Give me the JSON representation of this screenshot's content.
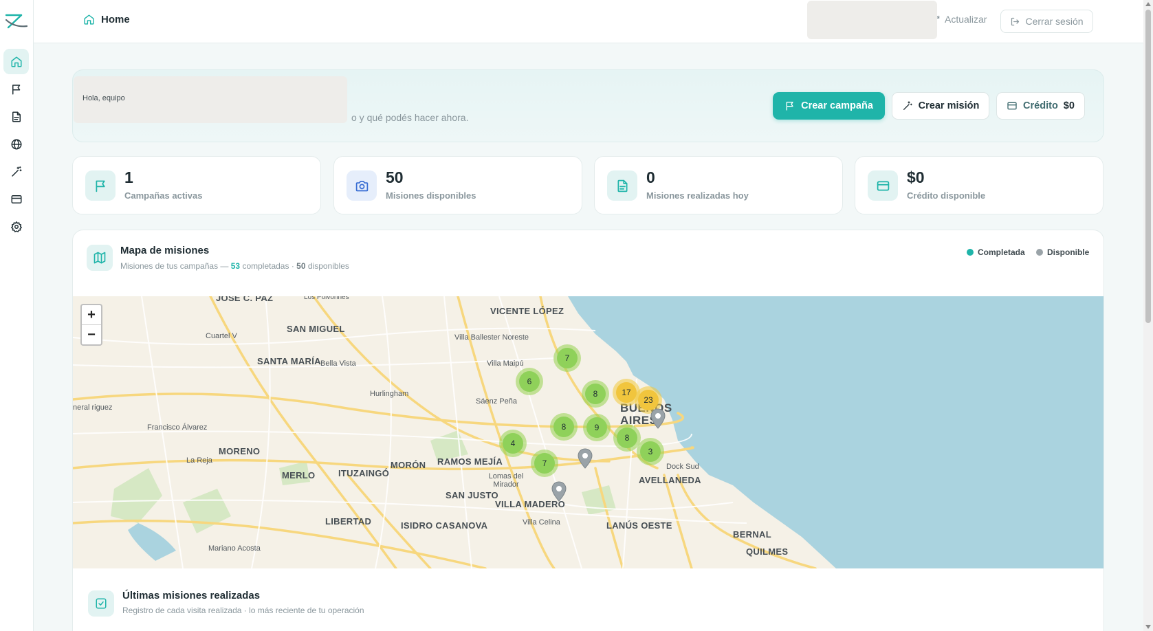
{
  "sidebar": {
    "items": [
      {
        "name": "home-icon"
      },
      {
        "name": "flag-icon"
      },
      {
        "name": "document-icon"
      },
      {
        "name": "globe-icon"
      },
      {
        "name": "wand-icon"
      },
      {
        "name": "card-icon"
      },
      {
        "name": "gear-icon"
      }
    ]
  },
  "topbar": {
    "breadcrumb": "Home",
    "refresh_label": "Actualizar",
    "logout_label": "Cerrar sesión"
  },
  "hero": {
    "greeting": "Hola, equipo",
    "subtitle": "o y qué podés hacer ahora.",
    "create_campaign": "Crear campaña",
    "create_mission": "Crear misión",
    "credit_label": "Crédito",
    "credit_value": "$0"
  },
  "stats": [
    {
      "value": "1",
      "label": "Campañas activas",
      "icon": "flag-icon"
    },
    {
      "value": "50",
      "label": "Misiones disponibles",
      "icon": "camera-icon"
    },
    {
      "value": "0",
      "label": "Misiones realizadas hoy",
      "icon": "document-icon"
    },
    {
      "value": "$0",
      "label": "Crédito disponible",
      "icon": "card-icon"
    }
  ],
  "map": {
    "title": "Mapa de misiones",
    "subtitle_prefix": "Misiones de tus campañas — ",
    "completed_count": "53",
    "completed_word": " completadas · ",
    "available_count": "50",
    "available_word": " disponibles",
    "legend": {
      "completed": "Completada",
      "available": "Disponible"
    },
    "zoom_in": "+",
    "zoom_out": "−",
    "clusters": [
      "7",
      "6",
      "8",
      "17",
      "23",
      "8",
      "9",
      "8",
      "4",
      "7",
      "3"
    ],
    "labels": {
      "jose_c_paz": "JOSÉ C. PAZ",
      "los_polvorines": "Los Polvorines",
      "vicente_lopez": "VICENTE LÓPEZ",
      "cuartel_v": "Cuartel V",
      "san_miguel": "SAN MIGUEL",
      "villa_ballester": "Villa Ballester Noreste",
      "santa_maria": "SANTA MARÍA",
      "bella_vista": "Bella Vista",
      "villa_maipu": "Villa Maipú",
      "hurlingham": "Hurlingham",
      "saenz_pena": "Sáenz Peña",
      "general_rodriguez": "neral riguez",
      "francisco_alvarez": "Francisco Álvarez",
      "buenos_aires": "BUENOS AIRES",
      "moreno": "MORENO",
      "la_reja": "La Reja",
      "moron": "MORÓN",
      "ramos_mejia": "RAMOS MEJÍA",
      "merlo": "MERLO",
      "ituzaingo": "ITUZAINGÓ",
      "lomas_del_mirador": "Lomas del Mirador",
      "dock_sud": "Dock Sud",
      "avellaneda": "AVELLANEDA",
      "san_justo": "SAN JUSTO",
      "villa_madero": "VILLA MADERO",
      "libertad": "LIBERTAD",
      "isidro_casanova": "ISIDRO CASANOVA",
      "villa_celina": "Villa Celina",
      "lanus_oeste": "LANÚS OESTE",
      "bernal": "BERNAL",
      "mariano_acosta": "Mariano Acosta",
      "quilmes": "QUILMES"
    }
  },
  "last_missions": {
    "title": "Últimas misiones realizadas",
    "subtitle": "Registro de cada visita realizada · lo más reciente de tu operación"
  },
  "colors": {
    "accent": "#1fb4a9",
    "completed": "#1fb4a9",
    "available": "#9aa3a8",
    "cluster_green": "#8fd15a",
    "cluster_yellow": "#f1c53d"
  }
}
